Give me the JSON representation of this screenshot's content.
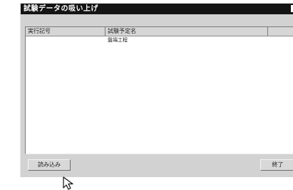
{
  "window": {
    "title": "試験データの吸い上げ"
  },
  "list": {
    "columns": [
      "実行記号",
      "試験予定名",
      ""
    ],
    "rows": [
      [
        "",
        "盤端工程",
        ""
      ]
    ]
  },
  "buttons": {
    "read_label": "読み込み",
    "close_label": "終了"
  },
  "cursor": {
    "icon": "arrow-pointer-icon"
  }
}
